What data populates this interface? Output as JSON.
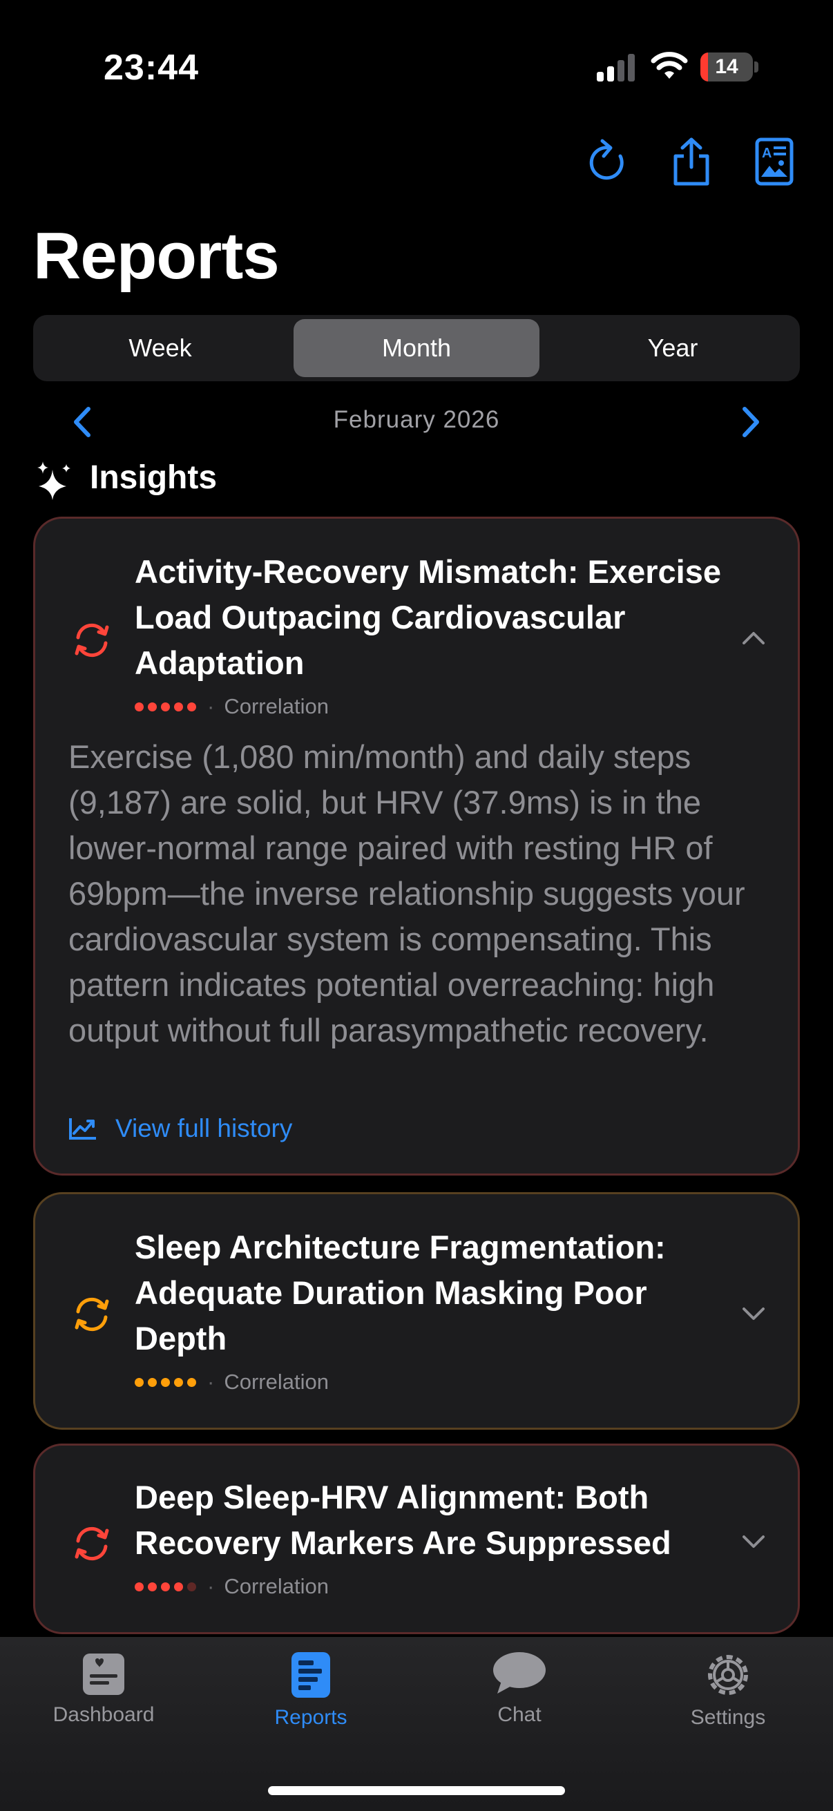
{
  "status_bar": {
    "time": "23:44",
    "battery_level": "14",
    "battery_fraction": 0.14,
    "battery_color": "#ff3b30",
    "icons": [
      "cellular-signal-icon",
      "wifi-icon",
      "battery-icon"
    ]
  },
  "toolbar": {
    "icons": [
      "refresh-icon",
      "share-icon",
      "report-document-icon"
    ],
    "accent": "#2f8cf7"
  },
  "page_title": "Reports",
  "period_selector": {
    "options": [
      "Week",
      "Month",
      "Year"
    ],
    "selected": "Month"
  },
  "date_nav": {
    "label": "February 2026",
    "prev_icon": "chevron-left-icon",
    "next_icon": "chevron-right-icon"
  },
  "insights": {
    "header": "Insights",
    "header_icon": "sparkles-icon",
    "cards": [
      {
        "title": "Activity-Recovery Mismatch: Exercise Load Outpacing Cardiovascular Adaptation",
        "category": "Correlation",
        "strength": 5,
        "strength_max": 5,
        "accent": "#ff453a",
        "icon": "cycle-arrows-icon",
        "expanded": true,
        "body": "Exercise (1,080 min/month) and daily steps (9,187) are solid, but HRV (37.9ms) is in the lower-normal range paired with resting HR of 69bpm—the inverse relationship suggests your cardiovascular system is compensating. This pattern indicates potential overreaching: high output without full parasympathetic recovery.",
        "link_label": "View full history",
        "link_icon": "trend-chart-icon"
      },
      {
        "title": "Sleep Architecture Fragmentation: Adequate Duration Masking Poor Depth",
        "category": "Correlation",
        "strength": 5,
        "strength_max": 5,
        "accent": "#ff9f0a",
        "icon": "cycle-arrows-icon",
        "expanded": false
      },
      {
        "title": "Deep Sleep-HRV Alignment: Both Recovery Markers Are Suppressed",
        "category": "Correlation",
        "strength": 4,
        "strength_max": 5,
        "accent": "#ff453a",
        "icon": "cycle-arrows-icon",
        "expanded": false
      }
    ]
  },
  "tab_bar": {
    "tabs": [
      {
        "label": "Dashboard",
        "icon": "dashboard-card-icon"
      },
      {
        "label": "Reports",
        "icon": "reports-icon"
      },
      {
        "label": "Chat",
        "icon": "chat-bubble-icon"
      },
      {
        "label": "Settings",
        "icon": "gear-icon"
      }
    ],
    "selected": "Reports",
    "active_color": "#2f8cf7"
  }
}
